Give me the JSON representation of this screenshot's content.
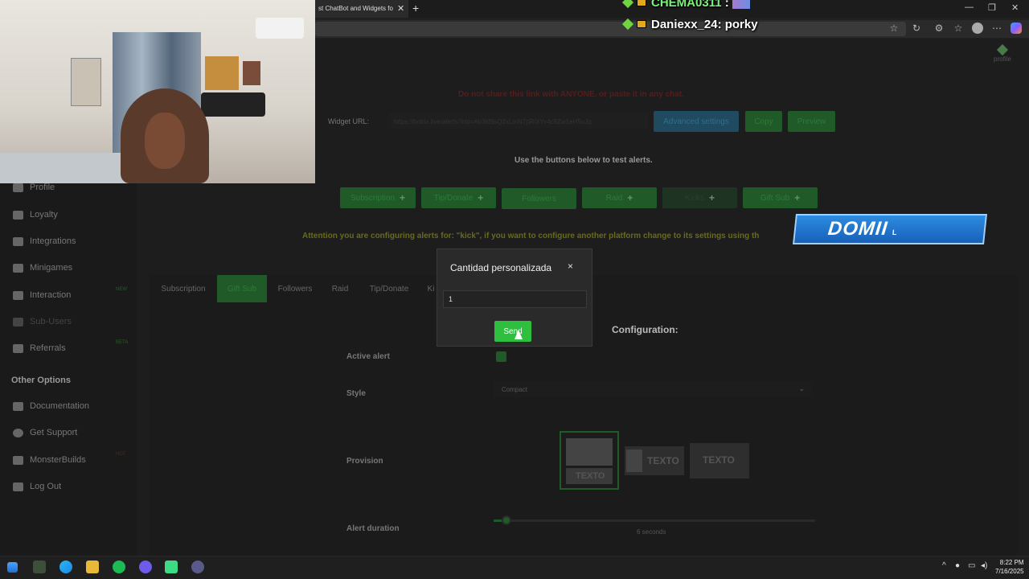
{
  "browser": {
    "tab_title": "st ChatBot and Widgets fo",
    "new_tab": "+",
    "close_tab": "✕"
  },
  "chat_overlay": {
    "line1_user": "CHEMA0311",
    "line1_sep": ":",
    "line2_user": "Daniexx_24",
    "line2_msg": ": porky"
  },
  "header": {
    "profile_label": "profile"
  },
  "warning": "Do not share this link with ANYONE, or paste it in any chat.",
  "widget": {
    "label": "Widget URL:",
    "url_blurred": "https://botrix.live/alerts?bid=Ab3kf9sQ2xLmN7pR0tYv4c8Zw1eH5uJq",
    "buttons": {
      "advanced": "Advanced settings",
      "copy": "Copy",
      "preview": "Preview"
    }
  },
  "test_text": "Use the buttons below to test alerts.",
  "test_buttons": [
    "Subscription",
    "Tip/Donate",
    "Followers",
    "Raid",
    "Kicks",
    "Gift Sub"
  ],
  "attention": "Attention you are configuring alerts for: \"kick\", if you want to configure another platform change to its settings using th",
  "sidebar": {
    "items": [
      {
        "label": "Profile",
        "badge": ""
      },
      {
        "label": "Loyalty",
        "badge": ""
      },
      {
        "label": "Integrations",
        "badge": ""
      },
      {
        "label": "Minigames",
        "badge": ""
      },
      {
        "label": "Interaction",
        "badge": "NEW"
      },
      {
        "label": "Sub-Users",
        "badge": ""
      },
      {
        "label": "Referrals",
        "badge": "BETA"
      }
    ],
    "other_heading": "Other Options",
    "other_items": [
      {
        "label": "Documentation",
        "badge": ""
      },
      {
        "label": "Get Support",
        "badge": ""
      },
      {
        "label": "MonsterBuilds",
        "badge": "HOT"
      },
      {
        "label": "Log Out",
        "badge": ""
      }
    ]
  },
  "alert_tabs": [
    "Subscription",
    "Gift Sub",
    "Followers",
    "Raid",
    "Tip/Donate",
    "Ki"
  ],
  "config": {
    "title": "Configuration:",
    "active_label": "Active alert",
    "style_label": "Style",
    "style_value": "Compact",
    "provision_label": "Provision",
    "provision_text": "TEXTO",
    "duration_label": "Alert duration",
    "duration_value": "6 seconds",
    "duration_fraction": 0.04
  },
  "modal": {
    "title": "Cantidad personalizada",
    "close": "×",
    "input_value": "1",
    "send": "Send"
  },
  "stream_overlay": {
    "text": "DOMII",
    "tail": "L"
  },
  "taskbar": {
    "time": "8:22 PM",
    "date": "7/16/2025"
  }
}
